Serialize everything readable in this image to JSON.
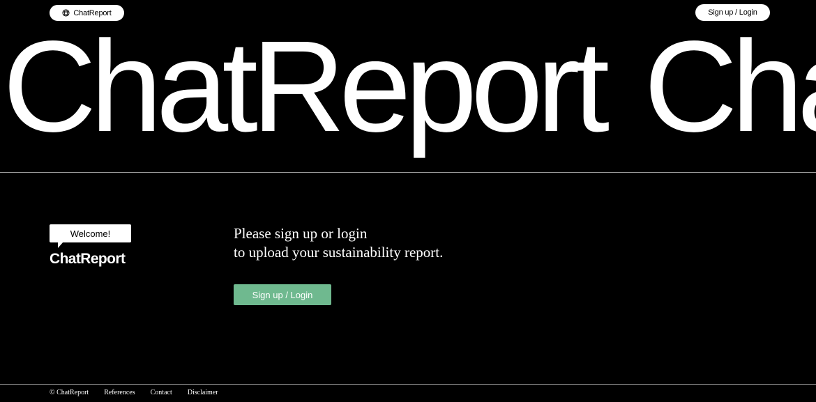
{
  "header": {
    "brand_label": "ChatReport",
    "brand_icon": "globe-icon",
    "login_label": "Sign up / Login"
  },
  "hero": {
    "word": "ChatReport",
    "word_repeat": "ChatReport"
  },
  "welcome": {
    "bubble_label": "Welcome!",
    "logo_text": "ChatReport"
  },
  "main": {
    "line1": "Please sign up or login",
    "line2": "to upload your sustainability report.",
    "cta_label": "Sign up / Login"
  },
  "footer": {
    "copyright": "© ChatReport",
    "links": [
      "References",
      "Contact",
      "Disclaimer"
    ]
  },
  "colors": {
    "background": "#000000",
    "foreground": "#ffffff",
    "accent": "#6fb98f"
  }
}
